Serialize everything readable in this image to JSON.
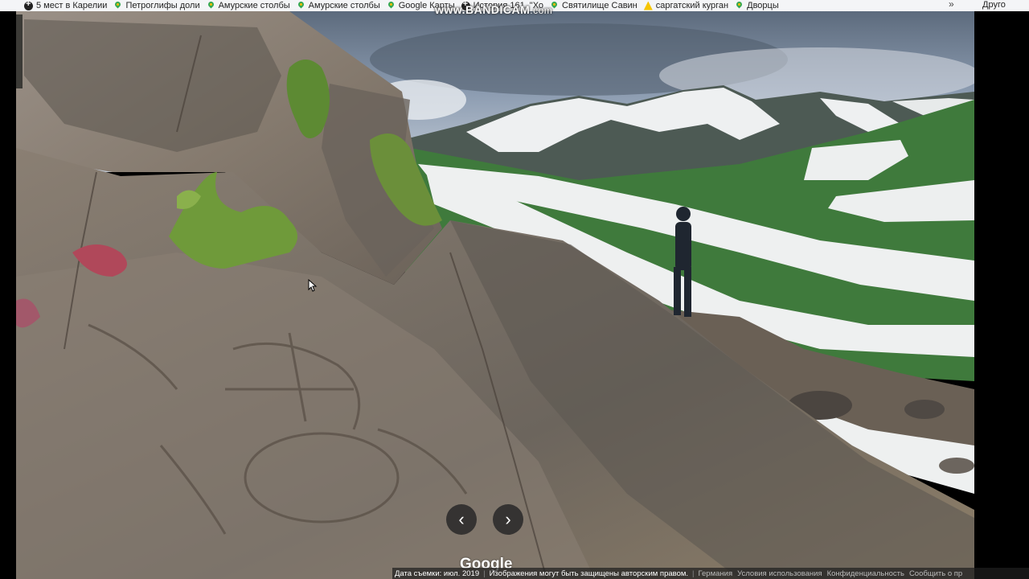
{
  "bookmarks": {
    "items": [
      {
        "label": "5 мест в Карелии",
        "icon": "plus-icon"
      },
      {
        "label": "Петроглифы доли",
        "icon": "google-maps-icon"
      },
      {
        "label": "Амурские столбы",
        "icon": "google-maps-icon"
      },
      {
        "label": "Амурские столбы",
        "icon": "google-maps-icon"
      },
      {
        "label": "Google Карты",
        "icon": "google-maps-icon"
      },
      {
        "label": "История 161. \"Хо",
        "icon": "plus-icon"
      },
      {
        "label": "Святилище Савин",
        "icon": "google-maps-icon"
      },
      {
        "label": "саргатский курган",
        "icon": "warning-icon"
      },
      {
        "label": "Дворцы",
        "icon": "google-maps-icon"
      }
    ],
    "more": "»",
    "other": "Друго"
  },
  "watermark": {
    "brand": "BANDICAM",
    "prefix": "www.",
    "domain": ".com"
  },
  "viewer": {
    "prev_label": "‹",
    "next_label": "›",
    "logo": "Google"
  },
  "footer": {
    "capture_date": "Дата съемки: июл. 2019",
    "copyright": "Изображения могут быть защищены авторским правом.",
    "country": "Германия",
    "terms": "Условия использования",
    "privacy": "Конфиденциальность",
    "report": "Сообщить о пр"
  },
  "colors": {
    "sky": "#8fa1b3",
    "rock": "#8d8173",
    "snow": "#eef0f0",
    "grass": "#3f7a3c"
  }
}
